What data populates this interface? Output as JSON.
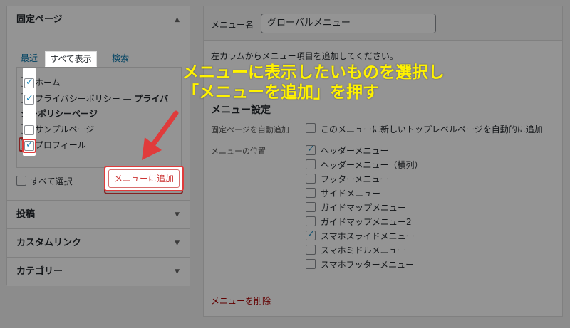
{
  "left": {
    "sections": {
      "pages": "固定ページ",
      "posts": "投稿",
      "custom_links": "カスタムリンク",
      "categories": "カテゴリー"
    },
    "tabs": [
      "最近",
      "すべて表示",
      "検索"
    ],
    "items": [
      {
        "label": "ホーム",
        "checked": true
      },
      {
        "label": "プライバシーポリシー —",
        "label_bold": "プライバ",
        "label_line2": "シーポリシーページ",
        "checked": true
      },
      {
        "label": "サンプルページ",
        "checked": false
      },
      {
        "label": "プロフィール",
        "checked": true
      }
    ],
    "select_all": "すべて選択",
    "add_button": "メニューに追加"
  },
  "right": {
    "menu_name_label": "メニュー名",
    "menu_name_value": "グローバルメニュー",
    "instructions": "左カラムからメニュー項目を追加してください。",
    "settings_title": "メニュー設定",
    "auto_add_label": "固定ページを自動追加",
    "auto_add_option": "このメニューに新しいトップレベルページを自動的に追加",
    "location_label": "メニューの位置",
    "locations": [
      {
        "label": "ヘッダーメニュー",
        "checked": true
      },
      {
        "label": "ヘッダーメニュー（横列）",
        "checked": false
      },
      {
        "label": "フッターメニュー",
        "checked": false
      },
      {
        "label": "サイドメニュー",
        "checked": false
      },
      {
        "label": "ガイドマップメニュー",
        "checked": false
      },
      {
        "label": "ガイドマップメニュー2",
        "checked": false
      },
      {
        "label": "スマホスライドメニュー",
        "checked": true
      },
      {
        "label": "スマホミドルメニュー",
        "checked": false
      },
      {
        "label": "スマホフッターメニュー",
        "checked": false
      }
    ],
    "delete_link": "メニューを削除"
  },
  "annotation": {
    "line1": "メニューに表示したいものを選択し",
    "line2": "「メニューを追加」を押す"
  },
  "colors": {
    "annotation": "#fff200",
    "highlight_red": "#e03b3b",
    "link": "#0073aa"
  },
  "icons": {
    "section_open": "triangle-up-icon",
    "section_closed": "triangle-down-icon"
  }
}
